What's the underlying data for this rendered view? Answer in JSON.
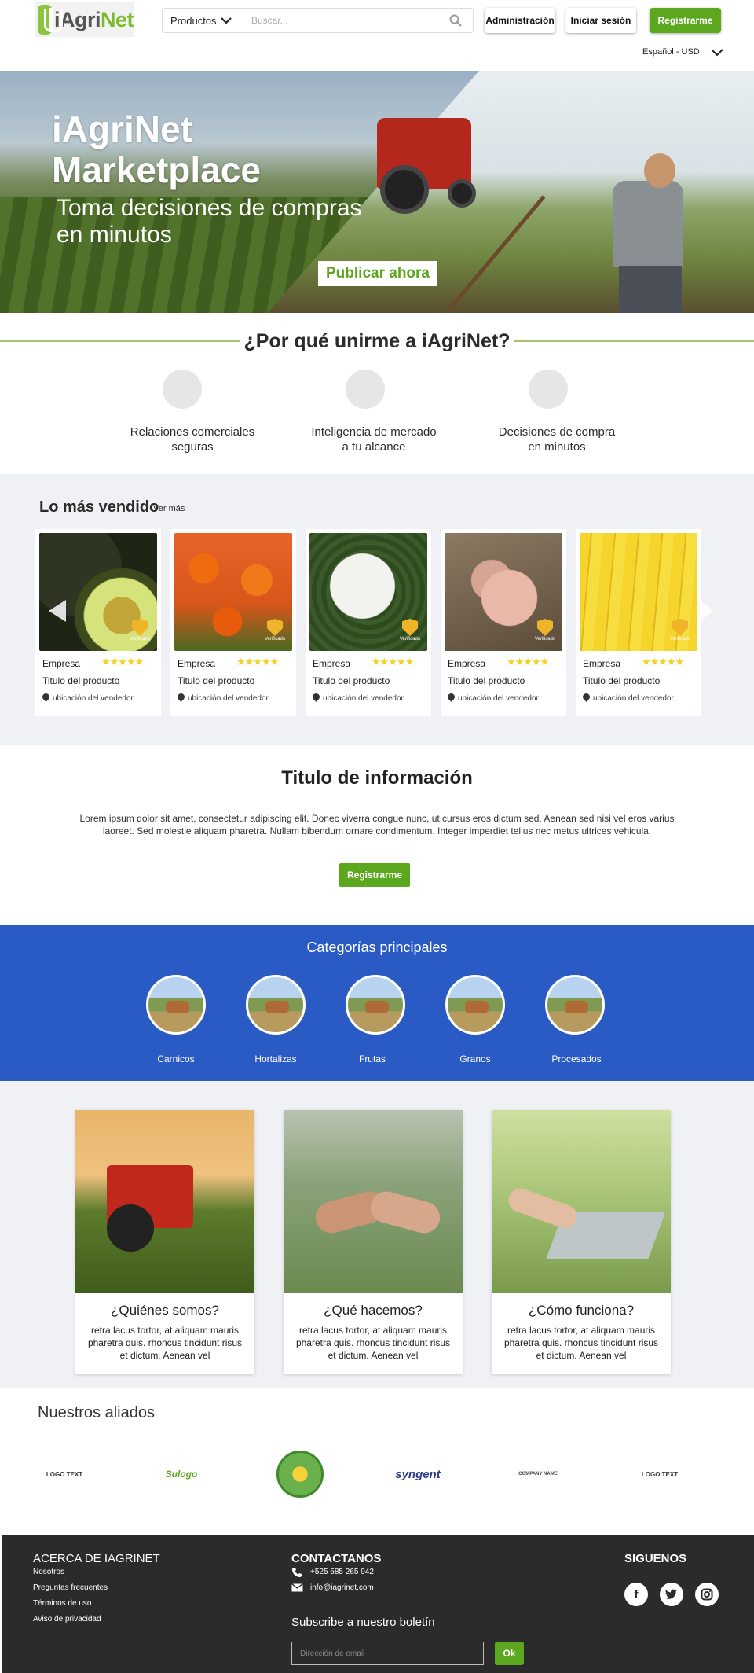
{
  "header": {
    "logo_prefix": "iAgri",
    "logo_suffix": "Net",
    "products_label": "Productos",
    "search_placeholder": "Buscar...",
    "admin_label": "Administración",
    "login_label": "Iniciar sesión",
    "register_label": "Registrarme",
    "locale_label": "Español - USD"
  },
  "hero": {
    "title_line1": "iAgriNet",
    "title_line2": "Marketplace",
    "subtitle_line1": "Toma decisiones de compras",
    "subtitle_line2": "en minutos",
    "cta": "Publicar ahora"
  },
  "why": {
    "title": "¿Por qué unirme a iAgriNet?",
    "items": [
      {
        "line1": "Relaciones comerciales",
        "line2": "seguras"
      },
      {
        "line1": "Inteligencia de mercado",
        "line2": "a tu alcance"
      },
      {
        "line1": "Decisiones de compra",
        "line2": "en minutos"
      }
    ]
  },
  "best_sellers": {
    "title": "Lo más vendido",
    "more": "Ver más",
    "products": [
      {
        "company": "Empresa",
        "title": "Titulo del producto",
        "location": "ubicación del vendedor",
        "verified": "Verificado",
        "rating": 5
      },
      {
        "company": "Empresa",
        "title": "Titulo del producto",
        "location": "ubicación del vendedor",
        "verified": "Verificado",
        "rating": 5
      },
      {
        "company": "Empresa",
        "title": "Titulo del producto",
        "location": "ubicación del vendedor",
        "verified": "Verificado",
        "rating": 5
      },
      {
        "company": "Empresa",
        "title": "Titulo del producto",
        "location": "ubicación del vendedor",
        "verified": "Verificado",
        "rating": 5
      },
      {
        "company": "Empresa",
        "title": "Titulo del producto",
        "location": "ubicación del vendedor",
        "verified": "Verificado",
        "rating": 5
      }
    ],
    "stars_glyph": "★★★★★"
  },
  "info": {
    "title": "Titulo de información",
    "text": "Lorem ipsum dolor sit amet, consectetur adipiscing elit. Donec viverra congue nunc, ut cursus eros dictum sed. Aenean sed nisi vel eros varius laoreet. Sed molestie aliquam pharetra. Nullam bibendum ornare condimentum. Integer imperdiet tellus nec metus ultrices vehicula.",
    "button": "Registrarme"
  },
  "categories": {
    "title": "Categorías principales",
    "items": [
      "Carnicos",
      "Hortalizas",
      "Frutas",
      "Granos",
      "Procesados"
    ]
  },
  "about": [
    {
      "title": "¿Quiénes somos?",
      "text": "retra lacus tortor, at aliquam mauris pharetra quis.  rhoncus tincidunt risus et dictum. Aenean vel"
    },
    {
      "title": "¿Qué hacemos?",
      "text": "retra lacus tortor, at aliquam mauris pharetra quis.  rhoncus tincidunt risus et dictum. Aenean vel"
    },
    {
      "title": "¿Cómo funciona?",
      "text": "retra lacus tortor, at aliquam mauris pharetra quis.  rhoncus tincidunt risus et dictum. Aenean vel"
    }
  ],
  "allies": {
    "title": "Nuestros aliados",
    "logos": [
      "LOGO TEXT",
      "Sulogo",
      "",
      "syngent",
      "COMPANY NAME",
      "LOGO TEXT"
    ]
  },
  "footer": {
    "about_heading": "ACERCA DE IAGRINET",
    "about_links": [
      "Nosotros",
      "Preguntas frecuentes",
      "Términos de uso",
      "Aviso de privacidad"
    ],
    "contact_heading": "CONTACTANOS",
    "phone": "+525 585 265 942",
    "email": "info@iagrinet.com",
    "newsletter": "Subscribe a nuestro boletín",
    "email_placeholder": "Dirección de email",
    "ok": "Ok",
    "follow_heading": "SIGUENOS"
  },
  "colors": {
    "brand_green": "#5ba81e",
    "category_blue": "#2a5ac3",
    "footer_dark": "#2b2b2b"
  }
}
